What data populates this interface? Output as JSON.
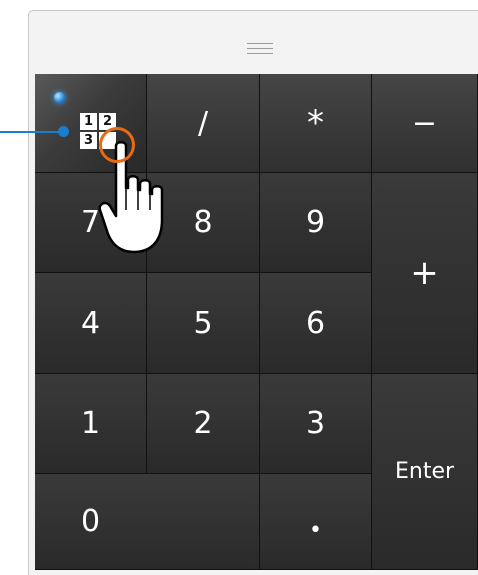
{
  "keypad": {
    "toggle_icon_digits": [
      "1",
      "2",
      "3",
      ""
    ],
    "keys": {
      "divide": "/",
      "multiply": "*",
      "minus": "−",
      "seven": "7",
      "eight": "8",
      "nine": "9",
      "plus": "+",
      "four": "4",
      "five": "5",
      "six": "6",
      "one": "1",
      "two": "2",
      "three": "3",
      "enter": "Enter",
      "zero": "0",
      "decimal": "•"
    }
  },
  "colors": {
    "led": "#2b8fe0",
    "pointer_line": "#1a7ecf",
    "highlight_circle": "#e86a12",
    "key_text": "#ffffff"
  },
  "icons": [
    "grip-icon",
    "numlock-led-icon",
    "numlock-grid-icon",
    "hand-cursor-icon"
  ]
}
